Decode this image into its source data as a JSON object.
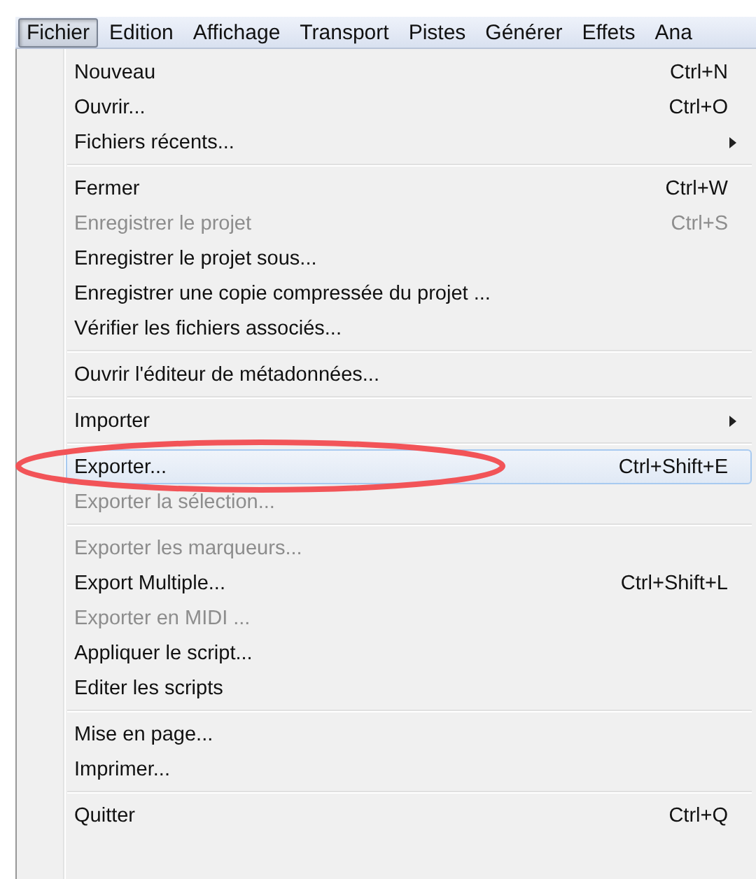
{
  "menubar": [
    {
      "label": "Fichier",
      "selected": true
    },
    {
      "label": "Edition",
      "selected": false
    },
    {
      "label": "Affichage",
      "selected": false
    },
    {
      "label": "Transport",
      "selected": false
    },
    {
      "label": "Pistes",
      "selected": false
    },
    {
      "label": "Générer",
      "selected": false
    },
    {
      "label": "Effets",
      "selected": false
    },
    {
      "label": "Ana",
      "selected": false
    }
  ],
  "menu": [
    {
      "kind": "item",
      "label": "Nouveau",
      "shortcut": "Ctrl+N",
      "disabled": false,
      "selected": false,
      "submenu": false
    },
    {
      "kind": "item",
      "label": "Ouvrir...",
      "shortcut": "Ctrl+O",
      "disabled": false,
      "selected": false,
      "submenu": false
    },
    {
      "kind": "item",
      "label": "Fichiers récents...",
      "disabled": false,
      "selected": false,
      "submenu": true
    },
    {
      "kind": "separator"
    },
    {
      "kind": "item",
      "label": "Fermer",
      "shortcut": "Ctrl+W",
      "disabled": false,
      "selected": false,
      "submenu": false
    },
    {
      "kind": "item",
      "label": "Enregistrer le projet",
      "shortcut": "Ctrl+S",
      "disabled": true,
      "selected": false,
      "submenu": false
    },
    {
      "kind": "item",
      "label": "Enregistrer le projet sous...",
      "disabled": false,
      "selected": false,
      "submenu": false
    },
    {
      "kind": "item",
      "label": "Enregistrer une copie compressée du projet ...",
      "disabled": false,
      "selected": false,
      "submenu": false
    },
    {
      "kind": "item",
      "label": "Vérifier les fichiers associés...",
      "disabled": false,
      "selected": false,
      "submenu": false
    },
    {
      "kind": "separator"
    },
    {
      "kind": "item",
      "label": "Ouvrir l'éditeur de métadonnées...",
      "disabled": false,
      "selected": false,
      "submenu": false
    },
    {
      "kind": "separator"
    },
    {
      "kind": "item",
      "label": "Importer",
      "disabled": false,
      "selected": false,
      "submenu": true
    },
    {
      "kind": "separator"
    },
    {
      "kind": "item",
      "label": "Exporter...",
      "shortcut": "Ctrl+Shift+E",
      "disabled": false,
      "selected": true,
      "submenu": false
    },
    {
      "kind": "item",
      "label": "Exporter la sélection...",
      "disabled": true,
      "selected": false,
      "submenu": false
    },
    {
      "kind": "separator"
    },
    {
      "kind": "item",
      "label": "Exporter les marqueurs...",
      "disabled": true,
      "selected": false,
      "submenu": false
    },
    {
      "kind": "item",
      "label": "Export Multiple...",
      "shortcut": "Ctrl+Shift+L",
      "disabled": false,
      "selected": false,
      "submenu": false
    },
    {
      "kind": "item",
      "label": "Exporter en MIDI ...",
      "disabled": true,
      "selected": false,
      "submenu": false
    },
    {
      "kind": "item",
      "label": "Appliquer le script...",
      "disabled": false,
      "selected": false,
      "submenu": false
    },
    {
      "kind": "item",
      "label": "Editer les scripts",
      "disabled": false,
      "selected": false,
      "submenu": false
    },
    {
      "kind": "separator"
    },
    {
      "kind": "item",
      "label": "Mise en page...",
      "disabled": false,
      "selected": false,
      "submenu": false
    },
    {
      "kind": "item",
      "label": "Imprimer...",
      "disabled": false,
      "selected": false,
      "submenu": false
    },
    {
      "kind": "separator"
    },
    {
      "kind": "item",
      "label": "Quitter",
      "shortcut": "Ctrl+Q",
      "disabled": false,
      "selected": false,
      "submenu": false
    }
  ],
  "annotation": {
    "kind": "ellipse",
    "color": "#f25458"
  }
}
